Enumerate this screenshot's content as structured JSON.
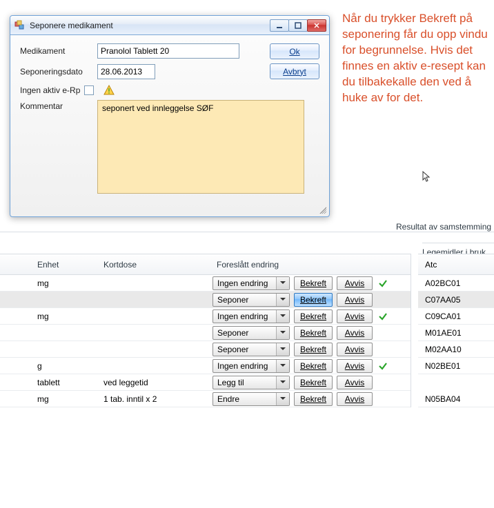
{
  "dialog": {
    "title": "Seponere medikament",
    "labels": {
      "medikament": "Medikament",
      "seponeringsdato": "Seponeringsdato",
      "ingen_aktiv": "Ingen aktiv e-Rp",
      "kommentar": "Kommentar"
    },
    "values": {
      "medikament": "Pranolol Tablett 20",
      "seponeringsdato": "28.06.2013",
      "kommentar": "seponert ved innleggelse SØF"
    },
    "buttons": {
      "ok": "Ok",
      "avbryt": "Avbryt"
    }
  },
  "annotation": "Når du trykker Bekreft på seponering får du opp vindu for begrunnelse. Hvis det finnes en aktiv e-resept kan du tilbakekalle den ved å huke av for det.",
  "section_title": "Resultat av samstemming",
  "panel_heading": "Legemidler i bruk",
  "grid": {
    "headers": {
      "enhet": "Enhet",
      "kortdose": "Kortdose",
      "foreslatt": "Foreslått endring",
      "atc": "Atc"
    },
    "common_buttons": {
      "bekreft": "Bekreft",
      "avvis": "Avvis"
    },
    "rows": [
      {
        "enhet": "mg",
        "kortdose": "",
        "endring": "Ingen endring",
        "atc": "A02BC01",
        "ok": true,
        "hl": false,
        "activeBekreft": false
      },
      {
        "enhet": "",
        "kortdose": "",
        "endring": "Seponer",
        "atc": "C07AA05",
        "ok": false,
        "hl": true,
        "activeBekreft": true
      },
      {
        "enhet": "mg",
        "kortdose": "",
        "endring": "Ingen endring",
        "atc": "C09CA01",
        "ok": true,
        "hl": false,
        "activeBekreft": false
      },
      {
        "enhet": "",
        "kortdose": "",
        "endring": "Seponer",
        "atc": "M01AE01",
        "ok": false,
        "hl": false,
        "activeBekreft": false
      },
      {
        "enhet": "",
        "kortdose": "",
        "endring": "Seponer",
        "atc": "M02AA10",
        "ok": false,
        "hl": false,
        "activeBekreft": false
      },
      {
        "enhet": "g",
        "kortdose": "",
        "endring": "Ingen endring",
        "atc": "N02BE01",
        "ok": true,
        "hl": false,
        "activeBekreft": false
      },
      {
        "enhet": "tablett",
        "kortdose": "ved leggetid",
        "endring": "Legg til",
        "atc": "",
        "ok": false,
        "hl": false,
        "activeBekreft": false,
        "atcBlank": true
      },
      {
        "enhet": "mg",
        "kortdose": "1 tab. inntil x 2",
        "endring": "Endre",
        "atc": "N05BA04",
        "ok": false,
        "hl": false,
        "activeBekreft": false
      }
    ]
  }
}
